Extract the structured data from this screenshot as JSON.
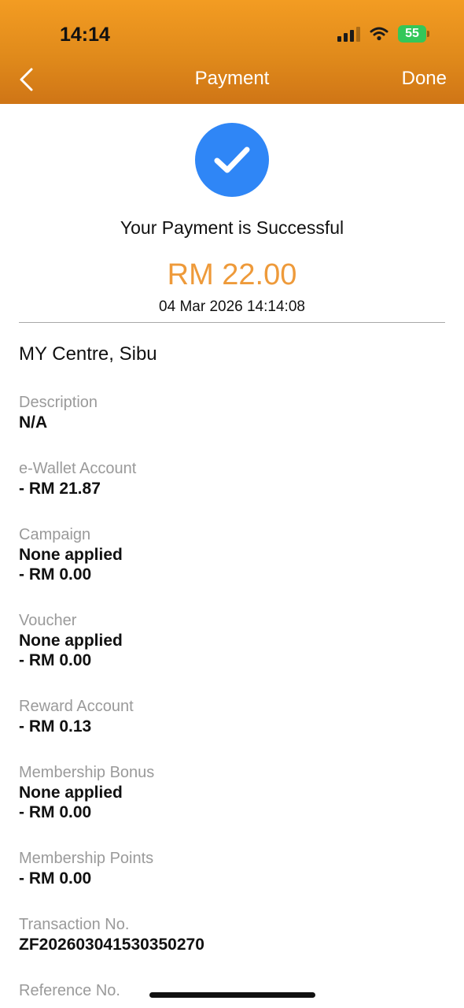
{
  "status_bar": {
    "time": "14:14",
    "battery": "55"
  },
  "nav": {
    "title": "Payment",
    "done_label": "Done"
  },
  "receipt": {
    "message": "Your Payment is Successful",
    "amount": "RM 22.00",
    "datetime": "04 Mar 2026 14:14:08",
    "merchant": "MY Centre, Sibu"
  },
  "details": [
    {
      "label": "Description",
      "lines": [
        "N/A"
      ]
    },
    {
      "label": "e-Wallet Account",
      "lines": [
        "- RM 21.87"
      ]
    },
    {
      "label": "Campaign",
      "lines": [
        "None applied",
        "- RM 0.00"
      ]
    },
    {
      "label": "Voucher",
      "lines": [
        "None applied",
        "- RM 0.00"
      ]
    },
    {
      "label": "Reward Account",
      "lines": [
        "- RM 0.13"
      ]
    },
    {
      "label": "Membership Bonus",
      "lines": [
        "None applied",
        "- RM 0.00"
      ]
    },
    {
      "label": "Membership Points",
      "lines": [
        "- RM 0.00"
      ]
    },
    {
      "label": "Transaction No.",
      "lines": [
        "ZF202603041530350270"
      ]
    },
    {
      "label": "Reference No.",
      "lines": []
    }
  ],
  "colors": {
    "header": "#e08a1b",
    "amount": "#ee9a3a",
    "check_circle": "#2f86f6",
    "battery": "#34c759"
  },
  "icons": {
    "back": "chevron-left-icon",
    "success": "checkmark-circle-icon",
    "signal": "cellular-signal-icon",
    "wifi": "wifi-icon",
    "battery": "battery-charging-icon"
  }
}
